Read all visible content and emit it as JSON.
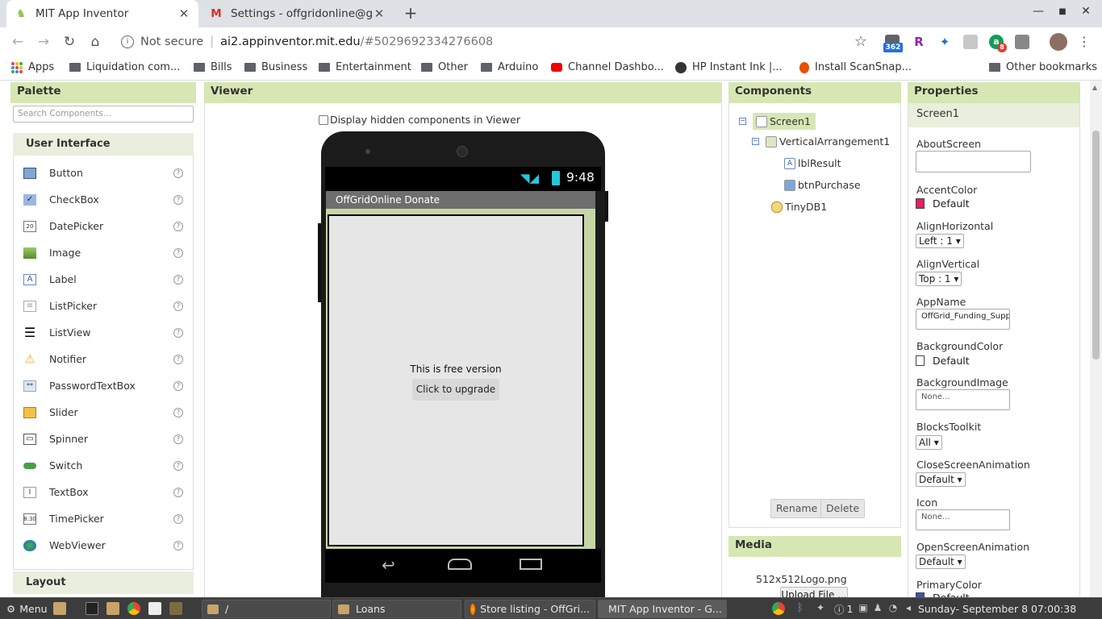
{
  "tabs": [
    {
      "title": "MIT App Inventor",
      "active": true
    },
    {
      "title": "Settings - offgridonline@gma",
      "active": false
    }
  ],
  "new_tab_label": "+",
  "window_controls": {
    "minimize": "—",
    "maximize": "■",
    "close": "✕"
  },
  "toolbar": {
    "not_secure": "Not secure",
    "url_host": "ai2.appinventor.mit.edu",
    "url_path": "/#5029692334276608",
    "ext_badge_1": "362",
    "ext_badge_2": "8"
  },
  "bookmarks": [
    {
      "label": "Apps",
      "icon": "apps-grid-icon"
    },
    {
      "label": "Liquidation com...",
      "icon": "folder-icon"
    },
    {
      "label": "Bills",
      "icon": "folder-icon"
    },
    {
      "label": "Business",
      "icon": "folder-icon"
    },
    {
      "label": "Entertainment",
      "icon": "folder-icon"
    },
    {
      "label": "Other",
      "icon": "folder-icon"
    },
    {
      "label": "Arduino",
      "icon": "folder-icon"
    },
    {
      "label": "Channel Dashbo...",
      "icon": "youtube-icon"
    },
    {
      "label": "HP Instant Ink |...",
      "icon": "globe-icon"
    },
    {
      "label": "Install ScanSnap...",
      "icon": "scansnap-icon"
    },
    {
      "label": "Other bookmarks",
      "icon": "folder-icon"
    }
  ],
  "palette": {
    "title": "Palette",
    "search_placeholder": "Search Components...",
    "category": "User Interface",
    "items": [
      {
        "label": "Button",
        "icon": "button-icon"
      },
      {
        "label": "CheckBox",
        "icon": "checkbox-icon"
      },
      {
        "label": "DatePicker",
        "icon": "datepicker-icon"
      },
      {
        "label": "Image",
        "icon": "image-icon"
      },
      {
        "label": "Label",
        "icon": "label-icon"
      },
      {
        "label": "ListPicker",
        "icon": "listpicker-icon"
      },
      {
        "label": "ListView",
        "icon": "listview-icon"
      },
      {
        "label": "Notifier",
        "icon": "notifier-icon"
      },
      {
        "label": "PasswordTextBox",
        "icon": "password-icon"
      },
      {
        "label": "Slider",
        "icon": "slider-icon"
      },
      {
        "label": "Spinner",
        "icon": "spinner-icon"
      },
      {
        "label": "Switch",
        "icon": "switch-icon"
      },
      {
        "label": "TextBox",
        "icon": "textbox-icon"
      },
      {
        "label": "TimePicker",
        "icon": "timepicker-icon"
      },
      {
        "label": "WebViewer",
        "icon": "webviewer-icon"
      }
    ],
    "help_glyph": "?",
    "next_category": "Layout"
  },
  "viewer": {
    "title": "Viewer",
    "hidden_checkbox_label": "Display hidden components in Viewer",
    "hidden_checked": false,
    "phone": {
      "time": "9:48",
      "app_title": "OffGridOnline Donate",
      "label_text": "This is free version",
      "button_text": "Click to upgrade"
    }
  },
  "components": {
    "title": "Components",
    "tree": [
      {
        "label": "Screen1",
        "toggle": "⊟"
      },
      {
        "label": "VerticalArrangement1",
        "toggle": "⊟"
      },
      {
        "label": "lblResult"
      },
      {
        "label": "btnPurchase"
      },
      {
        "label": "TinyDB1"
      }
    ],
    "rename_label": "Rename",
    "delete_label": "Delete"
  },
  "media": {
    "title": "Media",
    "item": "512x512Logo.png",
    "upload_label": "Upload File ..."
  },
  "properties": {
    "title": "Properties",
    "subject": "Screen1",
    "about_label": "AboutScreen",
    "about_value": "",
    "accent_label": "AccentColor",
    "accent_value": "Default",
    "accent_color": "#e91e63",
    "alignh_label": "AlignHorizontal",
    "alignh_value": "Left : 1 ▾",
    "alignv_label": "AlignVertical",
    "alignv_value": "Top : 1 ▾",
    "appname_label": "AppName",
    "appname_value": "OffGrid_Funding_Supp",
    "bgcolor_label": "BackgroundColor",
    "bgcolor_value": "Default",
    "bgcolor_color": "#ffffff",
    "bgimage_label": "BackgroundImage",
    "bgimage_value": "None...",
    "blocks_label": "BlocksToolkit",
    "blocks_value": "All ▾",
    "closeanim_label": "CloseScreenAnimation",
    "closeanim_value": "Default ▾",
    "icon_label": "Icon",
    "icon_value": "None...",
    "openanim_label": "OpenScreenAnimation",
    "openanim_value": "Default ▾",
    "primary_label": "PrimaryColor",
    "primary_value": "Default",
    "primary_color": "#3f51b5"
  },
  "taskbar": {
    "menu": "Menu",
    "windows": [
      {
        "label": "/",
        "icon": "folder-icon"
      },
      {
        "label": "Loans",
        "icon": "folder-icon"
      },
      {
        "label": "Store listing - OffGri...",
        "icon": "firefox-icon"
      },
      {
        "label": "MIT App Inventor - G...",
        "icon": "chrome-icon",
        "active": true
      }
    ],
    "tray_count": "1",
    "clock": "Sunday- September  8 07:00:38"
  }
}
